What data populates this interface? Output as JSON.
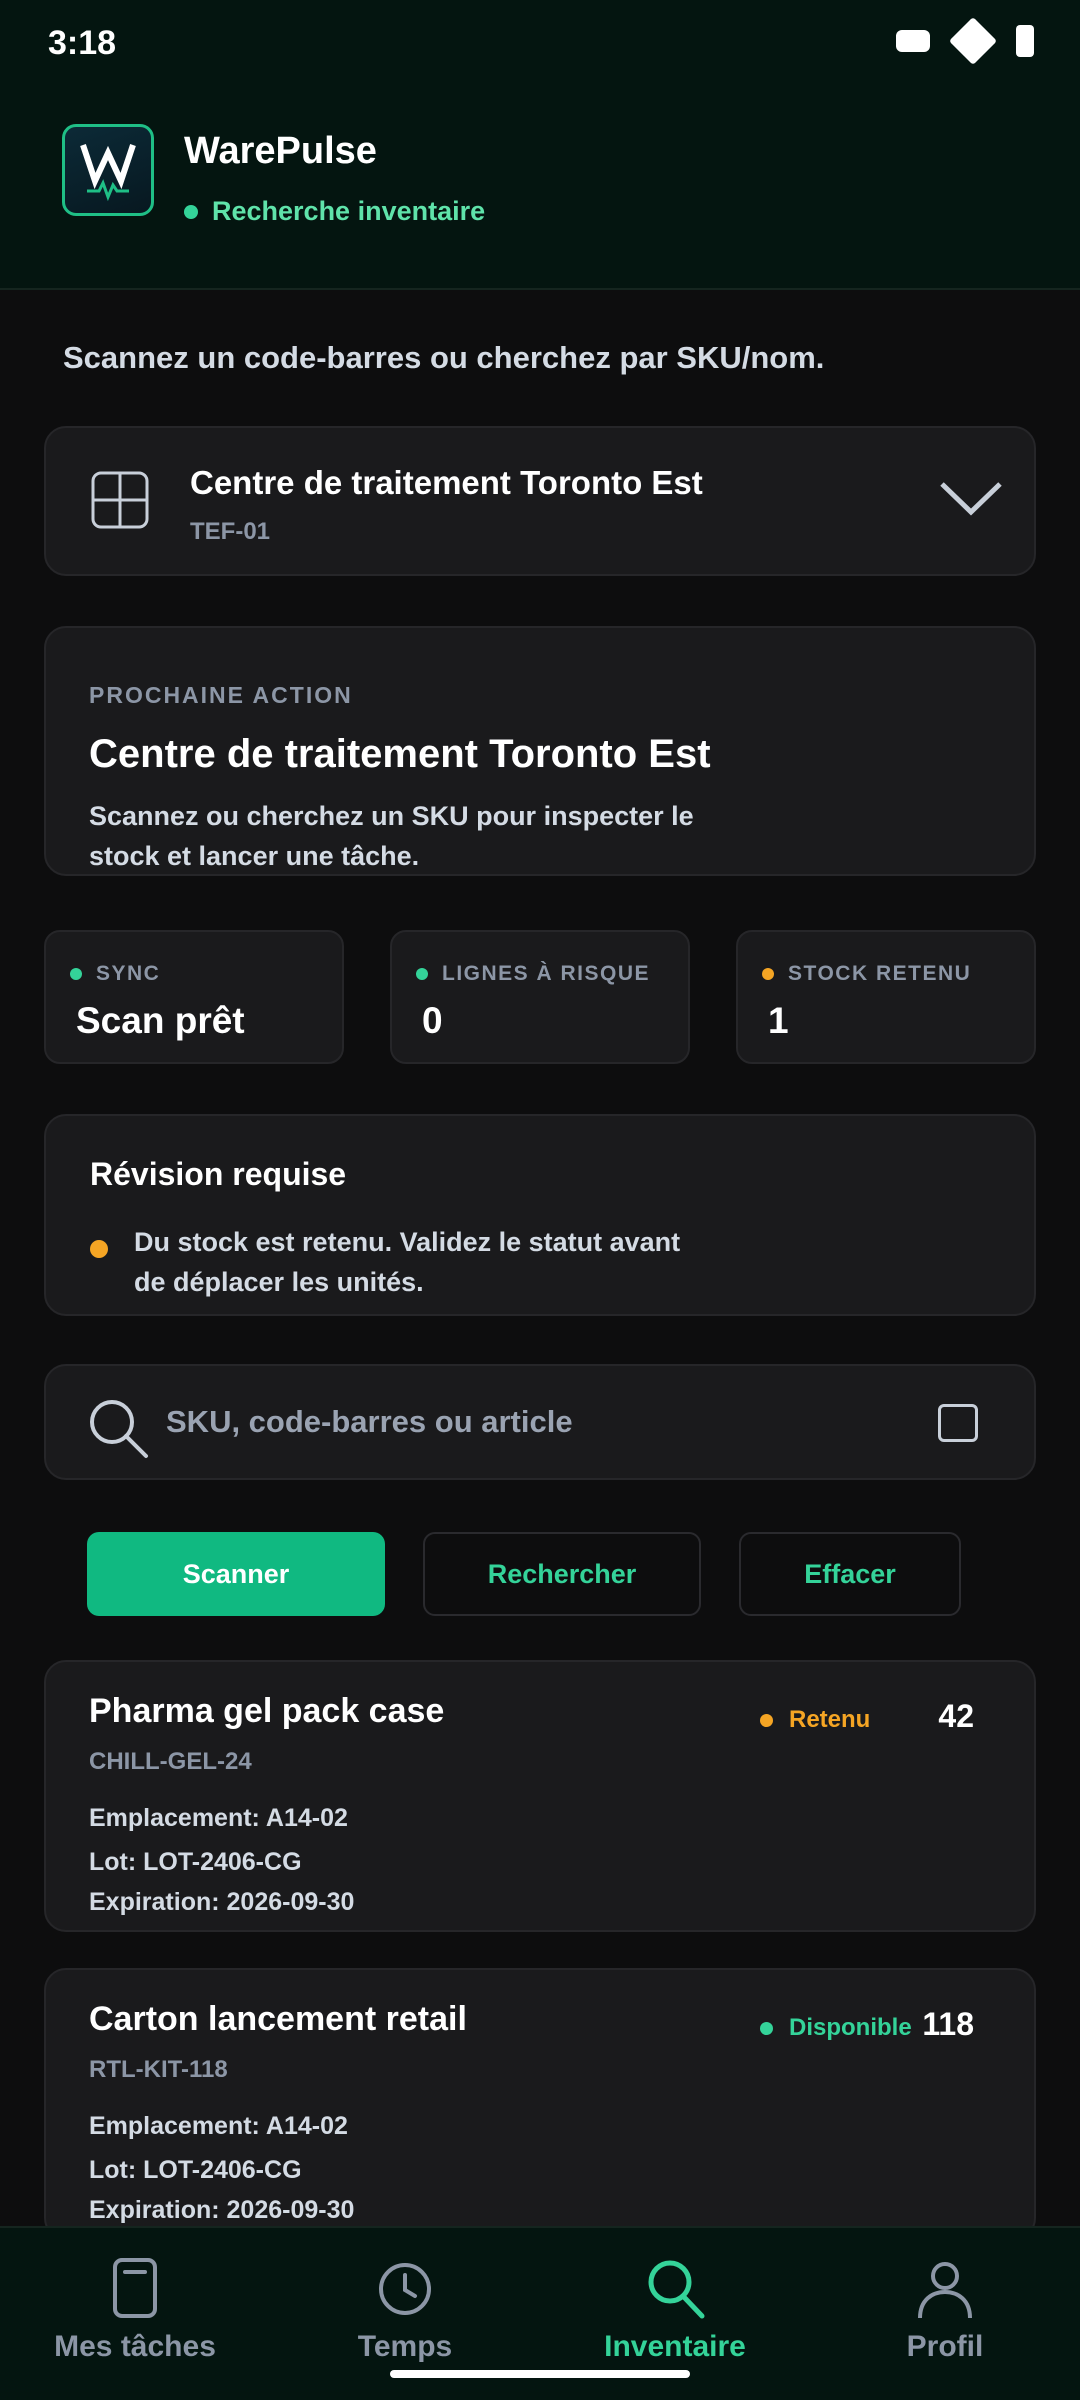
{
  "status_bar": {
    "time": "3:18"
  },
  "app": {
    "title": "WarePulse",
    "subtitle": "Recherche inventaire"
  },
  "intro": "Scannez un code-barres ou cherchez par SKU/nom.",
  "warehouse": {
    "name": "Centre de traitement Toronto Est",
    "code": "TEF-01"
  },
  "next_action": {
    "label": "PROCHAINE ACTION",
    "title": "Centre de traitement Toronto Est",
    "description": "Scannez ou cherchez un SKU pour inspecter le stock et lancer une tâche."
  },
  "stats": [
    {
      "label": "SYNC",
      "value": "Scan prêt",
      "status_color": "#34d399"
    },
    {
      "label": "LIGNES À RISQUE",
      "value": "0",
      "status_color": "#34d399"
    },
    {
      "label": "STOCK RETENU",
      "value": "1",
      "status_color": "#f5a524"
    }
  ],
  "review": {
    "title": "Révision requise",
    "message": "Du stock est retenu. Validez le statut avant de déplacer les unités."
  },
  "search": {
    "placeholder": "SKU, code-barres ou article",
    "value": ""
  },
  "actions": {
    "scan": "Scanner",
    "search": "Rechercher",
    "clear": "Effacer"
  },
  "items": [
    {
      "name": "Pharma gel pack case",
      "sku": "CHILL-GEL-24",
      "status": "Retenu",
      "status_color": "#f5a524",
      "quantity": "42",
      "location": "Emplacement: A14-02",
      "lot": "Lot: LOT-2406-CG",
      "expiration": "Expiration: 2026-09-30"
    },
    {
      "name": "Carton lancement retail",
      "sku": "RTL-KIT-118",
      "status": "Disponible",
      "status_color": "#34d399",
      "quantity": "118",
      "location": "Emplacement: A14-02",
      "lot": "Lot: LOT-2406-CG",
      "expiration": "Expiration: 2026-09-30"
    }
  ],
  "nav": [
    {
      "label": "Mes tâches",
      "icon": "clipboard-icon"
    },
    {
      "label": "Temps",
      "icon": "clock-icon"
    },
    {
      "label": "Inventaire",
      "icon": "search-icon",
      "active": true
    },
    {
      "label": "Profil",
      "icon": "user-icon"
    }
  ],
  "colors": {
    "accent": "#34d399",
    "primary_button": "#10b981",
    "warning": "#f5a524",
    "background": "#0d0d0e"
  }
}
